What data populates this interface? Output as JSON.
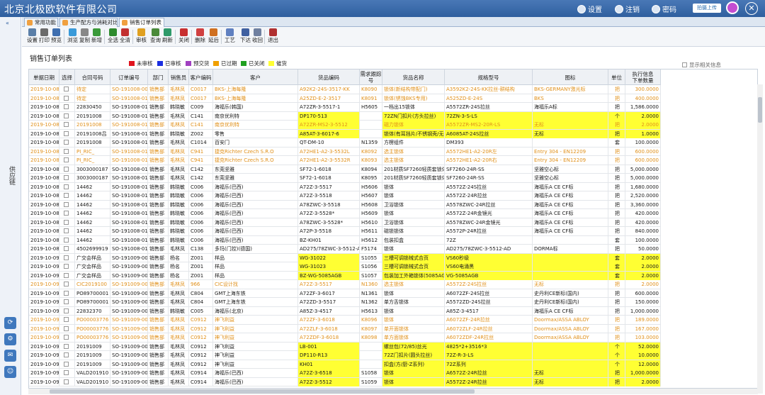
{
  "app": {
    "title": "北京北极欧软件有限公司"
  },
  "topbar": {
    "settings": "设置",
    "logout": "注销",
    "password": "密码",
    "upload": "拍摄上传",
    "close": "✕"
  },
  "leftbar": {
    "label": "供应链",
    "collapse": "«"
  },
  "tabs": [
    {
      "label": "常用功能",
      "active": false
    },
    {
      "label": "生产配方与消耗对比表",
      "active": false
    },
    {
      "label": "销售订单列表",
      "active": true
    }
  ],
  "toolbar": [
    {
      "label": "设置",
      "color": "#5b7fa8"
    },
    {
      "label": "打印",
      "color": "#6b6b6b"
    },
    {
      "label": "预览",
      "color": "#3f6fb0"
    },
    {
      "label": "浏览",
      "color": "#3a9ad9"
    },
    {
      "label": "复制",
      "color": "#888888"
    },
    {
      "label": "新增",
      "color": "#3a9a3a"
    },
    {
      "label": "全选",
      "color": "#2d8a2d"
    },
    {
      "label": "全清",
      "color": "#c23030"
    },
    {
      "label": "审核",
      "color": "#e0a020"
    },
    {
      "label": "查询",
      "color": "#4b8a3a"
    },
    {
      "label": "刷新",
      "color": "#2f9a6a"
    },
    {
      "label": "关闭",
      "color": "#c83030"
    },
    {
      "label": "删除",
      "color": "#d04040"
    },
    {
      "label": "延后",
      "color": "#d07020"
    },
    {
      "label": "工艺",
      "color": "#6080c0"
    },
    {
      "label": "下达",
      "color": "#4060a0"
    },
    {
      "label": "收回",
      "color": "#7080a0"
    },
    {
      "label": "退出",
      "color": "#b03030"
    }
  ],
  "page": {
    "title": "销售订单列表",
    "show_related": "显示相关信息"
  },
  "legend": [
    {
      "label": "未审核",
      "color": "#e0141e"
    },
    {
      "label": "已审核",
      "color": "#1a2ee0"
    },
    {
      "label": "预交货",
      "color": "#a040c0"
    },
    {
      "label": "已过期",
      "color": "#f0a000"
    },
    {
      "label": "已关闭",
      "color": "#20a020"
    },
    {
      "label": "催货",
      "color": "#ffff33"
    }
  ],
  "columns": [
    "单据日期",
    "选择",
    "合同号码",
    "订单编号",
    "部门",
    "销售员",
    "客户编码",
    "客户",
    "货品编码",
    "需求跟踪号",
    "货品名称",
    "规格型号",
    "图标",
    "单位",
    "执行信息\n下单数量"
  ],
  "rows": [
    [
      "2019-10-08",
      "",
      "待定",
      "SO-191008-009",
      "销售部",
      "毛林凤",
      "C0017",
      "BKS-上海每隆",
      "A92K2-24S-3517-KK",
      "K8090",
      "锁体(新结构带配门)",
      "A3592K2-24S-KK拉丝-耕结构",
      "BKS-GERMANY激光标",
      "把",
      "300.0000"
    ],
    [
      "2019-10-08",
      "",
      "待定",
      "SO-191008-010",
      "销售部",
      "毛林凤",
      "C0017",
      "BKS-上海每隆",
      "A25ZD-E-2-3517",
      "K8091",
      "锁体(锈蚀BKS专用)",
      "A525ZD-E-24S",
      "BKS",
      "把",
      "400.0000"
    ],
    [
      "2019-10-08",
      "",
      "22830450",
      "SO-191008-011",
      "销售部",
      "韩晓敏",
      "C009",
      "海福乐(韩国)",
      "A72ZR-3-5517-1",
      "H5605",
      "一档出15锁体",
      "A5572ZR-24S拉丝",
      "海福乐A标",
      "把",
      "1,586.0000"
    ],
    [
      "2019-10-08",
      "",
      "20191008",
      "SO-191008-012",
      "销售部",
      "毛林凤",
      "C141",
      "南京优利特",
      "DP170-513",
      "",
      "72ZN门扣片(方头拉丝)",
      "72ZN-3-S-LS",
      "",
      "个",
      "2.0000"
    ],
    [
      "2019-10-08",
      "",
      "20191008",
      "SO-191008-012",
      "销售部",
      "毛林凤",
      "C141",
      "南京优利特",
      "A72ZR-MS2-3-5512",
      "",
      "磁力锁体",
      "A5572ZR-MS2-20R-LS",
      "无标",
      "把",
      "2.0000"
    ],
    [
      "2019-10-08",
      "",
      "20191008吕",
      "SO-191008-014",
      "销售部",
      "韩晓敏",
      "Z002",
      "零售",
      "A85AT-3-6017-6",
      "",
      "锁体(有耳挡片/不锈钢壳/无钩/薄板)",
      "A6085AT-24S拉丝",
      "无标",
      "把",
      "1.0000"
    ],
    [
      "2019-10-08",
      "",
      "20191008",
      "SO-191008-015",
      "销售部",
      "毛林凤",
      "C1014",
      "百安门",
      "QT-DM-10",
      "N1359",
      "方楞组件",
      "DM393",
      "",
      "套",
      "100.0000"
    ],
    [
      "2019-10-08",
      "",
      "PI_RIC_",
      "SO-191008-016",
      "销售部",
      "毛林凤",
      "C941",
      "捷克Richter Czech S.R.O",
      "A72HE1-A2-3-5532L",
      "K8092",
      "选主锁体",
      "A5572HE1-A2-20R左",
      "Entry 304 - EN12209",
      "把",
      "600.0000"
    ],
    [
      "2019-10-08",
      "",
      "PI_RIC_",
      "SO-191008-016",
      "销售部",
      "毛林凤",
      "C941",
      "捷克Richter Czech S.R.O",
      "A72HE1-A2-3-5532R",
      "K8093",
      "选主锁体",
      "A5572HE1-A2-20R右",
      "Entry 304 - EN12209",
      "把",
      "600.0000"
    ],
    [
      "2019-10-08",
      "",
      "3003000187",
      "SO-191008-017",
      "销售部",
      "毛林凤",
      "C142",
      "东莞坚雅",
      "SF72-1-6018",
      "K8094",
      "201材质SF7260轻质套锁体",
      "SF7260-24R-SS",
      "坚雅空心标",
      "把",
      "5,000.0000"
    ],
    [
      "2019-10-08",
      "",
      "3003000187",
      "SO-191008-017",
      "销售部",
      "毛林凤",
      "C142",
      "东莞坚雅",
      "SF72-1-6018",
      "K8095",
      "201材质SF7260轻质套锁体",
      "SF7260-24R-SS",
      "坚雅空心标",
      "把",
      "5,000.0000"
    ],
    [
      "2019-10-08",
      "",
      "14462",
      "SO-191008-018",
      "销售部",
      "韩晓敏",
      "C006",
      "海福乐(巴西)",
      "A72Z-3-5517",
      "H5606",
      "锁体",
      "A5572Z-24S拉丝",
      "海福乐A CE CF标",
      "把",
      "1,680.0000"
    ],
    [
      "2019-10-08",
      "",
      "14462",
      "SO-191008-018",
      "销售部",
      "韩晓敏",
      "C006",
      "海福乐(巴西)",
      "A72Z-3-5518",
      "H5607",
      "锁体",
      "A5572Z-24R拉丝",
      "海福乐A CE CF标",
      "把",
      "2,520.0000"
    ],
    [
      "2019-10-08",
      "",
      "14462",
      "SO-191008-018",
      "销售部",
      "韩晓敏",
      "C006",
      "海福乐(巴西)",
      "A78ZWC-3-5518",
      "H5608",
      "卫浴锁体",
      "A5578ZWC-24R拉丝",
      "海福乐A CE CF标",
      "把",
      "3,360.0000"
    ],
    [
      "2019-10-08",
      "",
      "14462",
      "SO-191008-018",
      "销售部",
      "韩晓敏",
      "C006",
      "海福乐(巴西)",
      "A72Z-3-5528*",
      "H5609",
      "锁体",
      "A5572Z-24R金镜光",
      "海福乐A CE CF标",
      "把",
      "420.0000"
    ],
    [
      "2019-10-08",
      "",
      "14462",
      "SO-191008-018",
      "销售部",
      "韩晓敏",
      "C006",
      "海福乐(巴西)",
      "A78ZWC-3-5528*",
      "H5610",
      "卫浴锁体",
      "A5578ZWC-24R金镜光",
      "海福乐A CE CF标",
      "把",
      "420.0000"
    ],
    [
      "2019-10-08",
      "",
      "14462",
      "SO-191008-018",
      "销售部",
      "韩晓敏",
      "C006",
      "海福乐(巴西)",
      "A72P-3-5518",
      "H5611",
      "磁锁锁体",
      "A5572P-24R拉丝",
      "海福乐A CE CF标",
      "把",
      "840.0000"
    ],
    [
      "2019-10-08",
      "",
      "14462",
      "SO-191008-018",
      "销售部",
      "韩晓敏",
      "C006",
      "海福乐(巴西)",
      "BZ-KH01",
      "H5612",
      "包装扣盒",
      "72Z",
      "",
      "套",
      "100.0000"
    ],
    [
      "2019-10-08",
      "",
      "4502699919",
      "SO-191008-019",
      "销售部",
      "毛林凤",
      "C138",
      "多玛(门控)(德国)",
      "AD275/78ZWC-3-5512-AD",
      "F5174",
      "锁体",
      "AD275/78ZWC-3-5512-AD",
      "DORMA标",
      "把",
      "50.0000"
    ],
    [
      "2019-10-09",
      "",
      "广交会样品",
      "SO-191009-001",
      "销售部",
      "杨名",
      "Z001",
      "样品",
      "WG-31022",
      "S1055",
      "三槽可调锁械式合页",
      "VS60秒级",
      "",
      "套",
      "2.0000"
    ],
    [
      "2019-10-09",
      "",
      "广交会样品",
      "SO-191009-001",
      "销售部",
      "杨名",
      "Z001",
      "样品",
      "WG-31023",
      "S1056",
      "三槽可调锁械式合页",
      "VS60电涌黑",
      "",
      "套",
      "2.0000"
    ],
    [
      "2019-10-09",
      "",
      "广交会样品",
      "SO-191009-001",
      "销售部",
      "杨名",
      "Z001",
      "样品",
      "BZ-WG-5085AGB",
      "S1057",
      "包装加工外箱锁体(5085AGB)",
      "VG-5085AGB",
      "",
      "套",
      "2.0000"
    ],
    [
      "2019-10-09",
      "",
      "CIC2019100",
      "SO-191009-002",
      "销售部",
      "毛林凤",
      "966",
      "CIC设计找",
      "A72Z-3-5517",
      "N1360",
      "选主锁体",
      "A5572Z-24S拉丝",
      "无标",
      "把",
      "2.0000"
    ],
    [
      "2019-10-09",
      "",
      "PO89700001",
      "SO-191009-003",
      "销售部",
      "毛林凤",
      "C804",
      "GMT上海东铁",
      "A72ZF-3-6017",
      "N1361",
      "锁体",
      "A6072ZF-24S拉丝",
      "史丹利CE新标(国内)",
      "把",
      "600.0000"
    ],
    [
      "2019-10-09",
      "",
      "PO89700001",
      "SO-191009-004",
      "销售部",
      "毛林凤",
      "C804",
      "GMT上海东铁",
      "A72ZD-3-5517",
      "N1362",
      "单方舌锁体",
      "A5572ZD-24S拉丝",
      "史丹利CE新标(国内)",
      "把",
      "150.0000"
    ],
    [
      "2019-10-09",
      "",
      "22832370",
      "SO-191009-005",
      "销售部",
      "韩晓敏",
      "C005",
      "海福乐(北京)",
      "A85Z-3-4517",
      "H5613",
      "锁体",
      "A85Z-3-4517",
      "海福乐A CE CF标",
      "把",
      "1,000.0000"
    ],
    [
      "2019-10-09",
      "",
      "PO00003776",
      "SO-191009-006",
      "销售部",
      "毛林凤",
      "C0912",
      "神飞利益",
      "A72ZF-3-6018",
      "K8096",
      "锁体",
      "A6072ZF-24R拉丝",
      "Doormax/ASSA ABLOY",
      "把",
      "189.0000"
    ],
    [
      "2019-10-09",
      "",
      "PO00003776",
      "SO-191009-006",
      "销售部",
      "毛林凤",
      "C0912",
      "神飞利益",
      "A72ZLF-3-6018",
      "K8097",
      "单开面锁体",
      "A6072ZLF-24R拉丝",
      "Doormax/ASSA ABLOY",
      "把",
      "167.0000"
    ],
    [
      "2019-10-09",
      "",
      "PO00003776",
      "SO-191009-006",
      "销售部",
      "毛林凤",
      "C0912",
      "神飞利益",
      "A72ZDF-3-6018",
      "K8098",
      "单方面锁体",
      "A6072ZDF-24R拉丝",
      "Doormax/ASSA ABLOY",
      "把",
      "103.0000"
    ],
    [
      "2019-10-09",
      "",
      "20191009",
      "SO-191009-007",
      "销售部",
      "毛林凤",
      "C0912",
      "神飞利益",
      "LB-001",
      "",
      "螺丝包(72/85)丝光",
      "4825*2+3516*3",
      "",
      "个",
      "52.0000"
    ],
    [
      "2019-10-09",
      "",
      "20191009",
      "SO-191009-007",
      "销售部",
      "毛林凤",
      "C0912",
      "神飞利益",
      "DP110-R13",
      "",
      "72Z门扣片(圆头拉丝)",
      "72Z-R-3-LS",
      "",
      "个",
      "10.0000"
    ],
    [
      "2019-10-09",
      "",
      "20191009",
      "SO-191009-007",
      "销售部",
      "毛林凤",
      "C0912",
      "神飞利益",
      "KH01",
      "",
      "扣盒(方/厨-Z系列)",
      "72Z系列",
      "",
      "个",
      "12.0000"
    ],
    [
      "2019-10-09",
      "",
      "VALD201910",
      "SO-191009-008",
      "销售部",
      "毛林凤",
      "C0914",
      "海福乐(巴西)",
      "A72Z-3-6518",
      "S1058",
      "锁体",
      "A6572Z-24R拉丝",
      "无标",
      "把",
      "1,000.0000"
    ],
    [
      "2019-10-09",
      "",
      "VALD201910",
      "SO-191009-008",
      "销售部",
      "毛林凤",
      "C0914",
      "海福乐(巴西)",
      "A72Z-3-5512",
      "S1059",
      "锁体",
      "A5572Z-24R拉丝",
      "无标",
      "把",
      "2.0000"
    ]
  ],
  "row_status": [
    "late",
    "late",
    "none",
    "none",
    "late",
    "none",
    "none",
    "late",
    "late",
    "none",
    "none",
    "none",
    "none",
    "none",
    "none",
    "none",
    "none",
    "none",
    "none",
    "none",
    "none",
    "none",
    "late",
    "none",
    "none",
    "none",
    "late",
    "late",
    "late",
    "none",
    "none",
    "none",
    "none",
    "none"
  ],
  "highlight": {
    "3": [
      8,
      10,
      11,
      12,
      13,
      14
    ],
    "4": [
      8,
      10,
      11,
      12,
      13,
      14
    ],
    "5": [
      8,
      10,
      11,
      12,
      13,
      14
    ],
    "19": [
      8,
      10,
      11,
      12,
      13,
      14
    ],
    "20": [
      8,
      10,
      11,
      12,
      13,
      14
    ],
    "21": [
      8,
      10,
      11,
      12,
      13,
      14
    ],
    "29": [
      8,
      10,
      11,
      12,
      13,
      14
    ],
    "30": [
      8,
      10,
      11,
      12,
      13,
      14
    ],
    "31": [
      8,
      10,
      11,
      12,
      13,
      14
    ],
    "32": [
      8,
      10,
      11,
      12,
      13,
      14
    ],
    "33": [
      8,
      10,
      11,
      12,
      13,
      14
    ]
  },
  "colors": {
    "late_text": "#e0901a",
    "normal_text": "#1a1a1a",
    "highlight": "#ffff33",
    "header_blue": "#3a6aab"
  }
}
